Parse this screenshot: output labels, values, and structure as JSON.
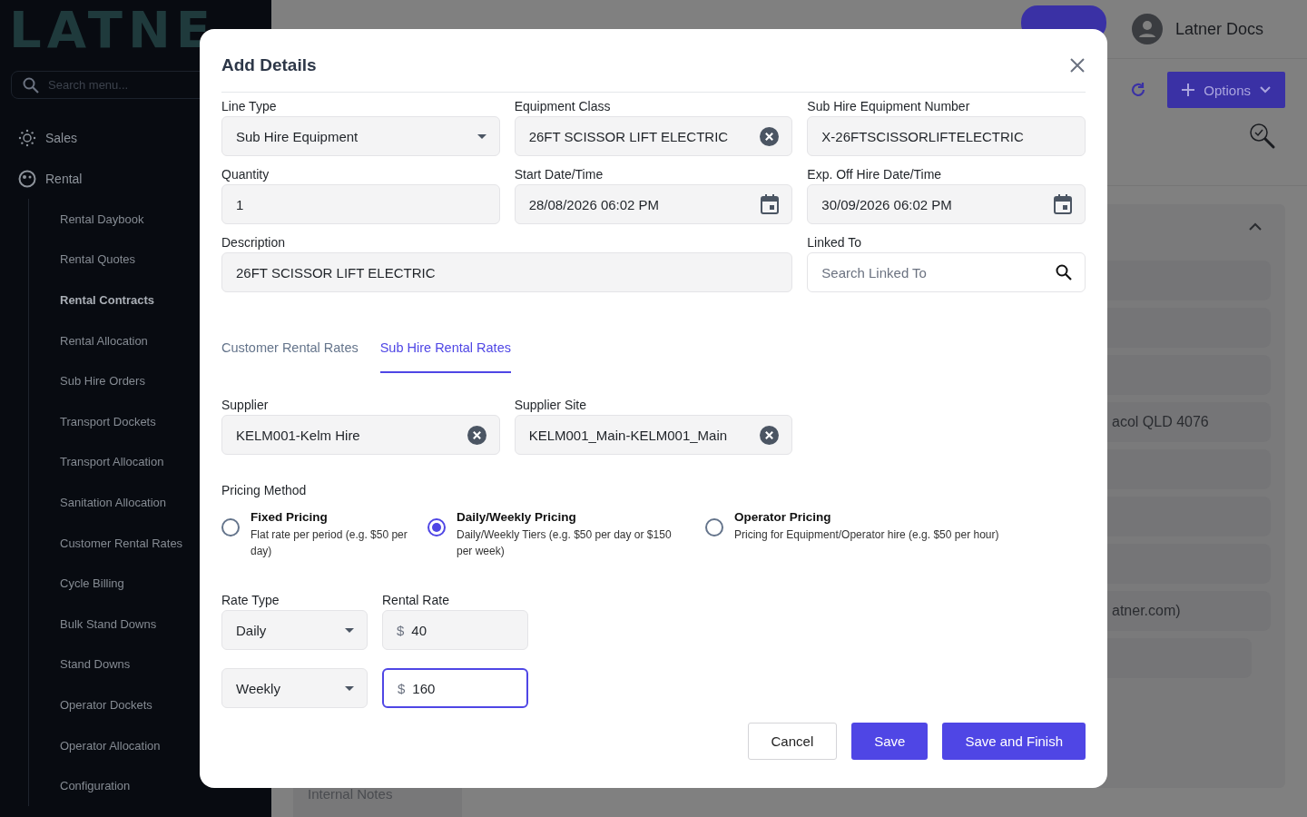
{
  "sidebar": {
    "logo": "LATNE",
    "search": {
      "placeholder": "Search menu..."
    },
    "items": [
      {
        "label": "Sales"
      },
      {
        "label": "Rental",
        "children": [
          {
            "label": "Rental Daybook",
            "selected": false
          },
          {
            "label": "Rental Quotes",
            "selected": false
          },
          {
            "label": "Rental Contracts",
            "selected": true
          },
          {
            "label": "Rental Allocation",
            "selected": false
          },
          {
            "label": "Sub Hire Orders",
            "selected": false
          },
          {
            "label": "Transport Dockets",
            "selected": false
          },
          {
            "label": "Transport Allocation",
            "selected": false
          },
          {
            "label": "Sanitation Allocation",
            "selected": false
          },
          {
            "label": "Customer Rental Rates",
            "selected": false
          },
          {
            "label": "Cycle Billing",
            "selected": false
          },
          {
            "label": "Bulk Stand Downs",
            "selected": false
          },
          {
            "label": "Stand Downs",
            "selected": false
          },
          {
            "label": "Operator Dockets",
            "selected": false
          },
          {
            "label": "Operator Allocation",
            "selected": false
          },
          {
            "label": "Configuration",
            "selected": false
          }
        ]
      }
    ]
  },
  "topbar": {
    "user": "Latner Docs"
  },
  "background": {
    "options": "Options",
    "fragments": [
      "acol QLD 4076",
      "atner.com)"
    ],
    "bottom_tab": "Internal Notes"
  },
  "dialog": {
    "title": "Add Details",
    "fields": [
      {
        "label": "Line Type",
        "value": "Sub Hire Equipment",
        "kind": "select"
      },
      {
        "label": "Equipment Class",
        "value": "26FT SCISSOR LIFT ELECTRIC",
        "kind": "clearable"
      },
      {
        "label": "Sub Hire Equipment Number",
        "value": "X-26FTSCISSORLIFTELECTRIC",
        "kind": "text"
      },
      {
        "label": "Quantity",
        "value": "1",
        "kind": "text"
      },
      {
        "label": "Start Date/Time",
        "value": "28/08/2026 06:02 PM",
        "kind": "date"
      },
      {
        "label": "Exp. Off Hire Date/Time",
        "value": "30/09/2026 06:02 PM",
        "kind": "date"
      },
      {
        "label": "Description",
        "value": "26FT SCISSOR LIFT ELECTRIC",
        "kind": "text"
      },
      {
        "label": "Linked To",
        "placeholder": "Search Linked To",
        "kind": "search"
      }
    ],
    "tabs": [
      {
        "label": "Customer Rental Rates",
        "selected": false
      },
      {
        "label": "Sub Hire Rental Rates",
        "selected": true
      }
    ],
    "supplier_fields": [
      {
        "label": "Supplier",
        "value": "KELM001-Kelm Hire",
        "kind": "clearable"
      },
      {
        "label": "Supplier Site",
        "value": "KELM001_Main-KELM001_Main",
        "kind": "clearable"
      }
    ],
    "pricing_method": {
      "label": "Pricing Method",
      "options": [
        {
          "title": "Fixed Pricing",
          "description": "Flat rate per period (e.g. $50 per day)",
          "selected": false
        },
        {
          "title": "Daily/Weekly Pricing",
          "description": "Daily/Weekly Tiers (e.g. $50 per day or $150 per week)",
          "selected": true
        },
        {
          "title": "Operator Pricing",
          "description": "Pricing for Equipment/Operator hire (e.g. $50 per hour)",
          "selected": false
        }
      ]
    },
    "rate_type_label": "Rate Type",
    "rental_rate_label": "Rental Rate",
    "rates": [
      {
        "rate_type": "Daily",
        "currency": "$",
        "rate": "40",
        "focused": false
      },
      {
        "rate_type": "Weekly",
        "currency": "$",
        "rate": "160",
        "focused": true
      }
    ],
    "buttons": [
      {
        "label": "Cancel",
        "kind": "secondary"
      },
      {
        "label": "Save",
        "kind": "primary"
      },
      {
        "label": "Save and Finish",
        "kind": "primary"
      }
    ]
  }
}
